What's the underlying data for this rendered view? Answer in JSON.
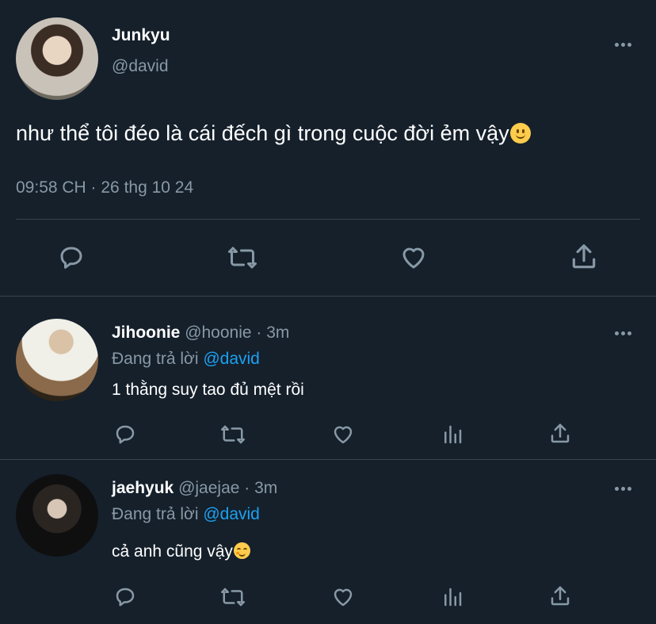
{
  "main_tweet": {
    "display_name": "Junkyu",
    "handle": "@david",
    "text": "như thể tôi đéo là cái đếch gì trong cuộc đời ẻm vậy",
    "emoji_icon": "slightly-smiling-face-icon",
    "timestamp": "09:58 CH · 26 thg 10 24"
  },
  "replies": [
    {
      "display_name": "Jihoonie",
      "handle": "@hoonie",
      "time": "· 3m",
      "replying_prefix": "Đang trả lời",
      "replying_to": "@david",
      "text": "1 thằng suy tao đủ mệt rồi"
    },
    {
      "display_name": "jaehyuk",
      "handle": "@jaejae",
      "time": "· 3m",
      "replying_prefix": "Đang trả lời",
      "replying_to": "@david",
      "text": "cả anh cũng vậy",
      "emoji_icon": "relieved-face-icon"
    }
  ],
  "colors": {
    "background": "#15202b",
    "text": "#ffffff",
    "muted": "#8899a6",
    "link": "#1da1f2",
    "divider": "#38444d"
  }
}
